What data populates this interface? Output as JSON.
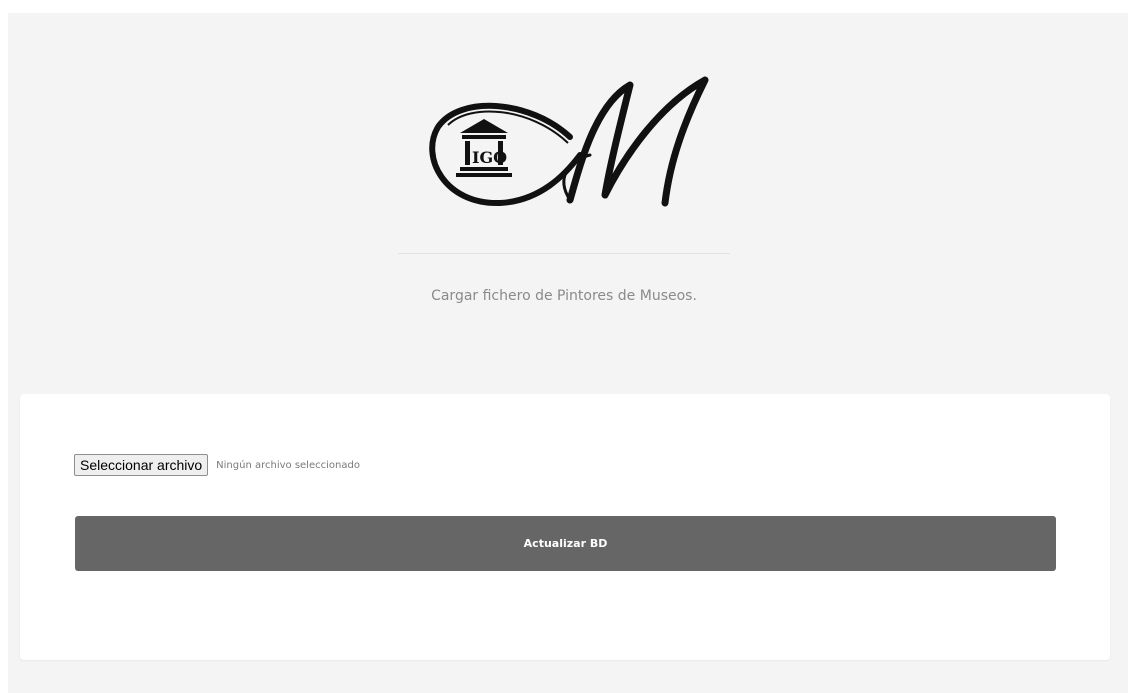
{
  "header": {
    "logo": {
      "name": "museum-logo",
      "emblem_text": "IGO",
      "letter": "M"
    },
    "subtitle": "Cargar fichero de Pintores de Museos."
  },
  "form": {
    "file_button_label": "Seleccionar archivo",
    "file_status": "Ningún archivo seleccionado",
    "submit_label": "Actualizar BD"
  },
  "colors": {
    "page_background": "#f4f4f4",
    "card_background": "#ffffff",
    "submit_background": "#666666",
    "subtitle_text": "#8a8a8a"
  }
}
